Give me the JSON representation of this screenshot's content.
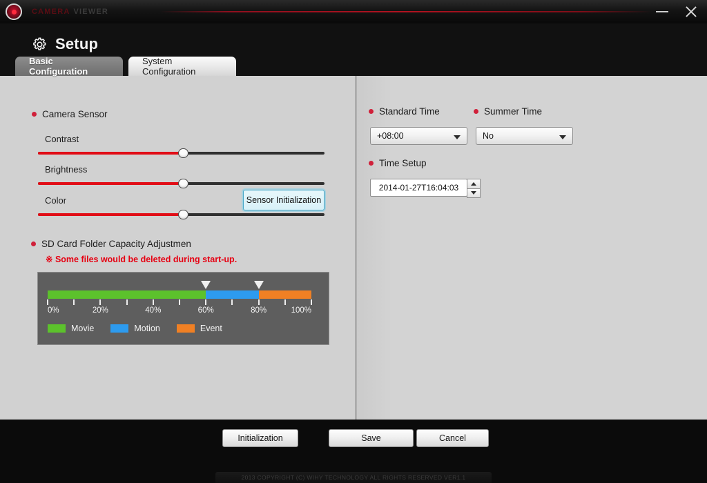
{
  "titlebar": {
    "brand_primary": "CAMERA",
    "brand_secondary": "VIEWER",
    "logo_icon": "camera-lens-logo-icon",
    "minimize_icon": "minimize-icon",
    "close_icon": "close-icon"
  },
  "header": {
    "icon": "gear-icon",
    "title": "Setup"
  },
  "tabs": [
    {
      "label": "Basic Configuration",
      "active": true
    },
    {
      "label": "System Configuration",
      "active": false
    }
  ],
  "left_pane": {
    "camera_sensor": {
      "label": "Camera Sensor"
    },
    "sensor_init_button": {
      "label": "Sensor Initialization"
    },
    "sliders": [
      {
        "label": "Contrast",
        "value": 50.5
      },
      {
        "label": "Brightness",
        "value": 50.5
      },
      {
        "label": "Color",
        "value": 50.5
      }
    ],
    "sd_card": {
      "label": "SD Card Folder Capacity Adjustmen",
      "warning": "※ Some files would be deleted during start-up."
    }
  },
  "chart_data": {
    "type": "bar",
    "title": "SD Card Folder Capacity Adjustmen",
    "orientation": "horizontal-stacked",
    "xlabel": "",
    "ylabel": "",
    "xlim": [
      0,
      100
    ],
    "grid": false,
    "legend_position": "bottom-left",
    "tick_values": [
      0,
      10,
      20,
      30,
      40,
      50,
      60,
      70,
      80,
      90,
      100
    ],
    "tick_labels": [
      "0%",
      "",
      "20%",
      "",
      "40%",
      "",
      "60%",
      "",
      "80%",
      "",
      "100%"
    ],
    "handles": [
      60,
      80
    ],
    "categories": [
      "Movie",
      "Motion",
      "Event"
    ],
    "values": [
      60,
      20,
      20
    ],
    "ranges": [
      [
        0,
        60
      ],
      [
        60,
        80
      ],
      [
        80,
        100
      ]
    ],
    "colors": [
      "#5cc22c",
      "#2d9bef",
      "#f08024"
    ],
    "legend": [
      {
        "name": "Movie",
        "color": "#5cc22c",
        "value": 60
      },
      {
        "name": "Motion",
        "color": "#2d9bef",
        "value": 20
      },
      {
        "name": "Event",
        "color": "#f08024",
        "value": 20
      }
    ]
  },
  "right_pane": {
    "standard_time": {
      "label": "Standard Time",
      "value": "+08:00",
      "dropdown_icon": "chevron-down-icon"
    },
    "summer_time": {
      "label": "Summer Time",
      "value": "No",
      "dropdown_icon": "chevron-down-icon"
    },
    "time_setup": {
      "label": "Time Setup",
      "value": "2014-01-27T16:04:03",
      "up_icon": "caret-up-icon",
      "down_icon": "caret-down-icon"
    }
  },
  "footer": {
    "buttons": [
      {
        "label": "Initialization"
      },
      {
        "label": "Save"
      },
      {
        "label": "Cancel"
      }
    ],
    "copyright": "2013 COPYRIGHT (C) WIHY TECHNOLOGY ALL RIGHTS RESERVED VER1.1"
  },
  "colors": {
    "accent_red": "#e10d16",
    "bullet_red": "#d0203a",
    "warning_red": "#e60012",
    "panel_gray": "#d1d1d1",
    "capacity_box": "#5e5e5e",
    "focus_blue": "#49a7c7"
  }
}
